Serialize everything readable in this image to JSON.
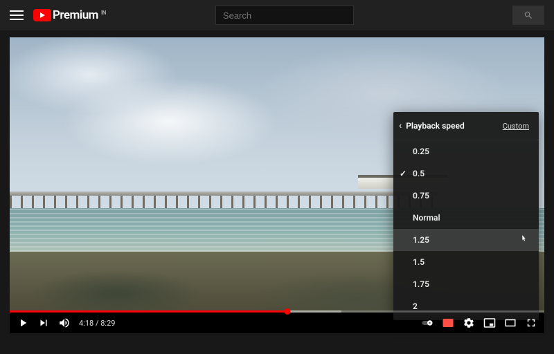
{
  "header": {
    "brand_text": "Premium",
    "region_code": "IN",
    "search_placeholder": "Search"
  },
  "player": {
    "current_time": "4:18",
    "duration": "8:29",
    "time_separator": " / ",
    "progress_percent": 52
  },
  "speed_menu": {
    "title": "Playback speed",
    "custom_label": "Custom",
    "selected": "0.5",
    "hovered": "1.25",
    "options": [
      "0.25",
      "0.5",
      "0.75",
      "Normal",
      "1.25",
      "1.5",
      "1.75",
      "2"
    ]
  }
}
